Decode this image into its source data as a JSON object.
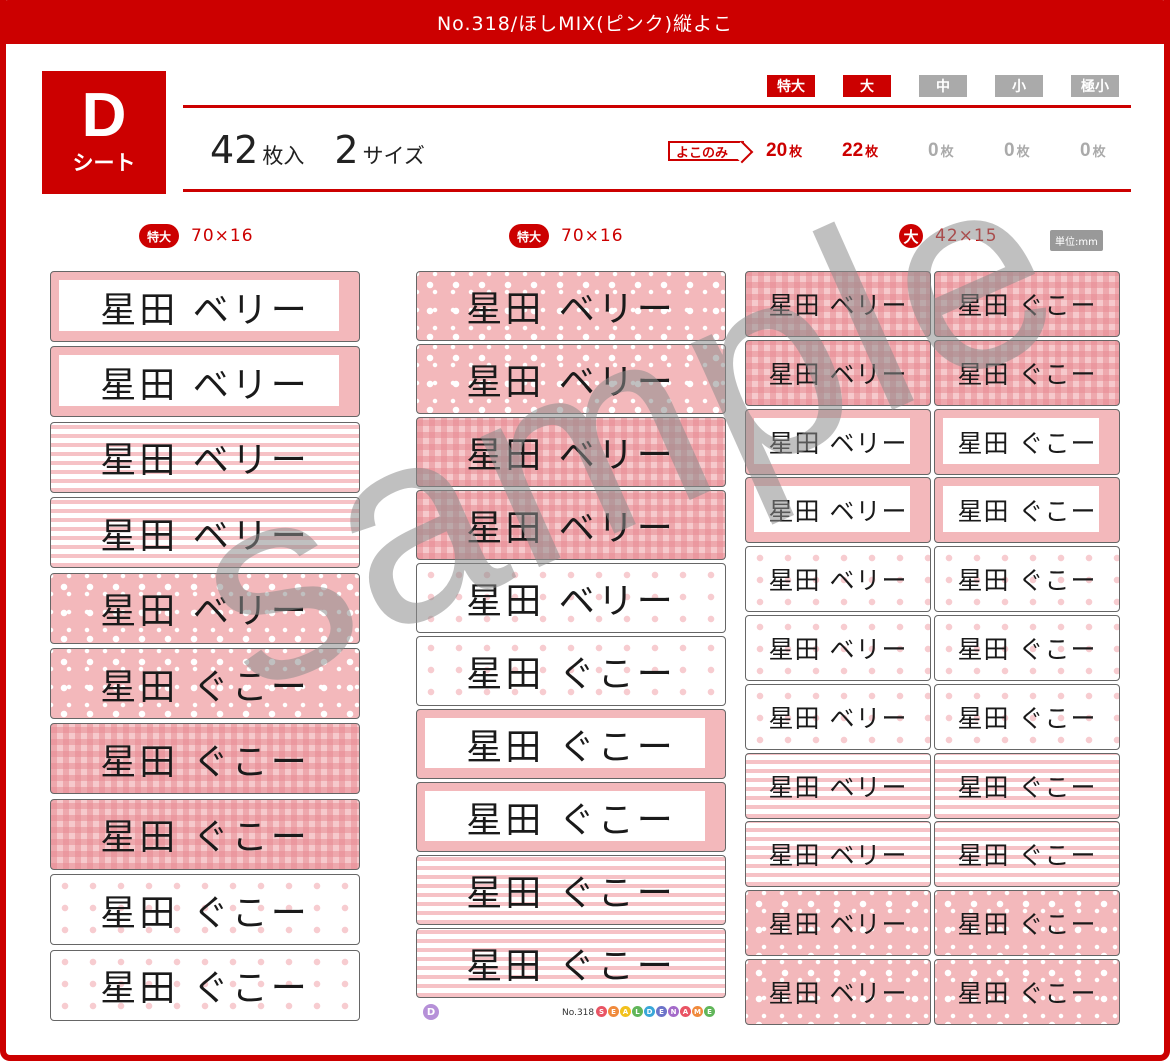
{
  "title": "No.318/ほしMIX(ピンク)縦よこ",
  "sheet": {
    "letter": "D",
    "label": "シート"
  },
  "count": {
    "sheets": "42",
    "sheets_unit": "枚入",
    "sizes": "2",
    "sizes_unit": "サイズ"
  },
  "size_labels": [
    "特大",
    "大",
    "中",
    "小",
    "極小"
  ],
  "size_counts": [
    "20",
    "22",
    "0",
    "0",
    "0"
  ],
  "count_unit": "枚",
  "yoko_only": "よこのみ",
  "unit_badge": "単位:mm",
  "columns": [
    {
      "badge": "特大",
      "dims": "70×16"
    },
    {
      "badge": "特大",
      "dims": "70×16"
    },
    {
      "badge": "大",
      "dims": "42×15"
    }
  ],
  "names": {
    "a": "星田 ベリー",
    "b": "星田 ぐこー"
  },
  "watermark": "sample",
  "footer": {
    "badge": "D",
    "number": "No.318",
    "brand": "SEALDENAME"
  },
  "colors": {
    "brand_red": "#cc0000",
    "label_pink": "#f3b8bb",
    "inactive_gray": "#aaaaaa"
  }
}
